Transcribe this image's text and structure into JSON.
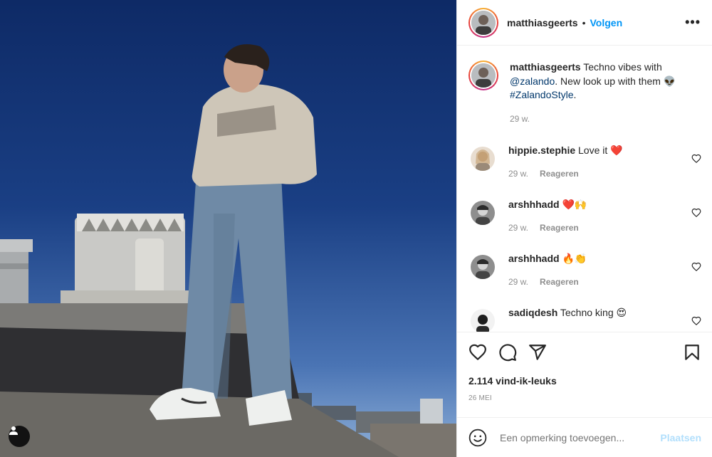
{
  "post": {
    "username": "matthiasgeerts",
    "separator": "•",
    "follow_label": "Volgen",
    "more_label": "•••",
    "caption": {
      "username": "matthiasgeerts",
      "text_before": " Techno vibes with ",
      "mention": "@zalando",
      "text_after": ". New look up with them 👽 ",
      "hashtag": "#ZalandoStyle",
      "text_end": ".",
      "time": "29 w."
    },
    "comments": [
      {
        "username": "hippie.stephie",
        "text": "Love it ❤️",
        "time": "29 w.",
        "reply": "Reageren"
      },
      {
        "username": "arshhhadd",
        "text": "❤️🙌",
        "time": "29 w.",
        "reply": "Reageren"
      },
      {
        "username": "arshhhadd",
        "text": "🔥👏",
        "time": "29 w.",
        "reply": "Reageren"
      },
      {
        "username": "sadiqdesh",
        "text": "Techno king 😍",
        "time": "",
        "reply": ""
      }
    ],
    "likes": "2.114 vind-ik-leuks",
    "date": "26 MEI",
    "add_comment_placeholder": "Een opmerking toevoegen...",
    "post_label": "Plaatsen"
  },
  "icons": {
    "like": "heart-icon",
    "comment": "comment-icon",
    "share": "share-icon",
    "save": "bookmark-icon",
    "emoji": "emoji-icon",
    "tag": "user-tag-icon"
  },
  "colors": {
    "accent": "#0095f6",
    "post_disabled": "#b2dffc",
    "muted": "#8e8e8e",
    "link": "#00376b"
  }
}
